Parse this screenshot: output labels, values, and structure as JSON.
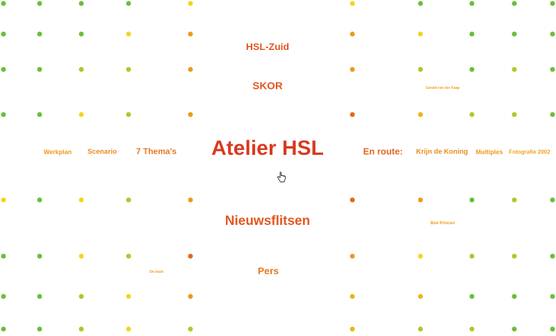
{
  "colors": {
    "yellow": "#f2d51e",
    "lime": "#a6cc2a",
    "green": "#6cbd3a",
    "orange": "#ec9a1e",
    "dark_orange": "#e06a1c",
    "gold": "#f0b418",
    "nav_main": "#d9391f",
    "nav_mid": "#e2571f",
    "nav_side": "#ef9a1a"
  },
  "dots": {
    "columns": {
      "c1": [
        "green",
        "green",
        "green",
        "green",
        "yellow",
        "green",
        "green",
        "green"
      ],
      "c2": [
        "green",
        "green",
        "green",
        "green",
        "green",
        "green",
        "green",
        "green"
      ],
      "c3": [
        "green",
        "green",
        "lime",
        "yellow",
        "yellow",
        "yellow",
        "lime",
        "lime"
      ],
      "c4": [
        "green",
        "yellow",
        "lime",
        "lime",
        "lime",
        "lime",
        "yellow",
        "yellow"
      ],
      "c5": [
        "yellow",
        "orange",
        "orange",
        "orange",
        "orange",
        "dark_orange",
        "orange",
        "lime"
      ],
      "c6": [
        "yellow",
        "orange",
        "orange",
        "dark_orange",
        "dark_orange",
        "orange",
        "gold",
        "gold"
      ],
      "c7": [
        "green",
        "yellow",
        "lime",
        "gold",
        "orange",
        "yellow",
        "gold",
        "lime"
      ],
      "c8": [
        "green",
        "green",
        "green",
        "lime",
        "green",
        "lime",
        "green",
        "lime"
      ],
      "c9": [
        "green",
        "green",
        "lime",
        "lime",
        "lime",
        "lime",
        "green",
        "green"
      ],
      "c10": [
        "green",
        "green",
        "green",
        "green",
        "green",
        "green",
        "green",
        "green"
      ]
    }
  },
  "nav": {
    "title": "Atelier HSL",
    "hsl_zuid": "HSL-Zuid",
    "skor": "SKOR",
    "nieuwsflitsen": "Nieuwsflitsen",
    "pers": "Pers",
    "werkplan": "Werkplan",
    "scenario": "Scenario",
    "themas": "7 Thema's",
    "en_route": "En route:",
    "krijn": "Krijn de Koning",
    "multiples": "Multiples",
    "fotografie": "Fotografie 2002",
    "gerald": "Gerald van der Kaap",
    "boe": "Boe Princen",
    "on_track": "On track",
    "top_tiny": " ",
    "top_tiny2": " ",
    "bottom_tiny": " "
  }
}
